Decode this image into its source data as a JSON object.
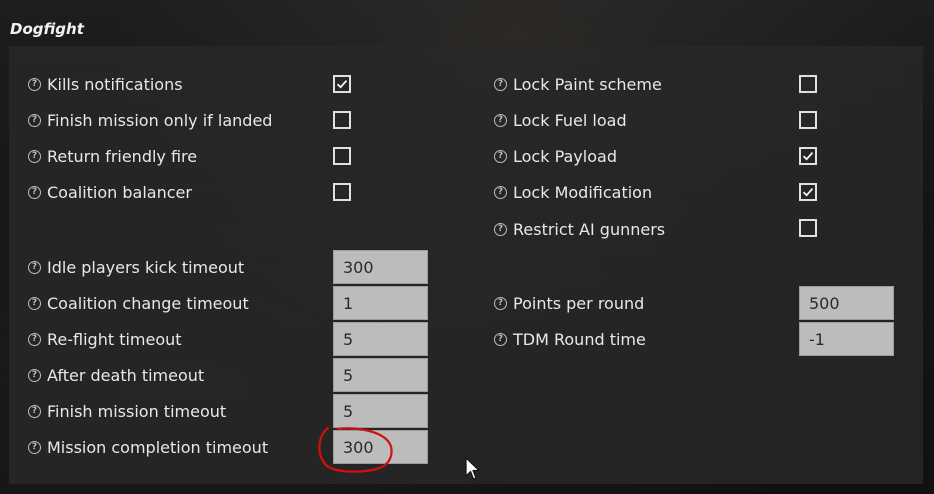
{
  "section_title": "Dogfight",
  "left_checkboxes": [
    {
      "label": "Kills notifications",
      "checked": true
    },
    {
      "label": "Finish mission only if landed",
      "checked": false
    },
    {
      "label": "Return friendly fire",
      "checked": false
    },
    {
      "label": "Coalition balancer",
      "checked": false
    }
  ],
  "right_checkboxes": [
    {
      "label": "Lock Paint scheme",
      "checked": false
    },
    {
      "label": "Lock Fuel load",
      "checked": false
    },
    {
      "label": "Lock Payload",
      "checked": true
    },
    {
      "label": "Lock Modification",
      "checked": true
    },
    {
      "label": "Restrict AI gunners",
      "checked": false
    }
  ],
  "left_fields": [
    {
      "label": "Idle players kick timeout",
      "value": "300"
    },
    {
      "label": "Coalition change timeout",
      "value": "1"
    },
    {
      "label": "Re-flight timeout",
      "value": "5"
    },
    {
      "label": "After death timeout",
      "value": "5"
    },
    {
      "label": "Finish mission timeout",
      "value": "5"
    },
    {
      "label": "Mission completion timeout",
      "value": "300"
    }
  ],
  "right_fields": [
    {
      "label": "Points per round",
      "value": "500"
    },
    {
      "label": "TDM Round time",
      "value": "-1"
    }
  ],
  "help_icon_glyph": "?",
  "colors": {
    "annotation_circle": "#d01010",
    "input_bg": "#bcbcbc"
  }
}
